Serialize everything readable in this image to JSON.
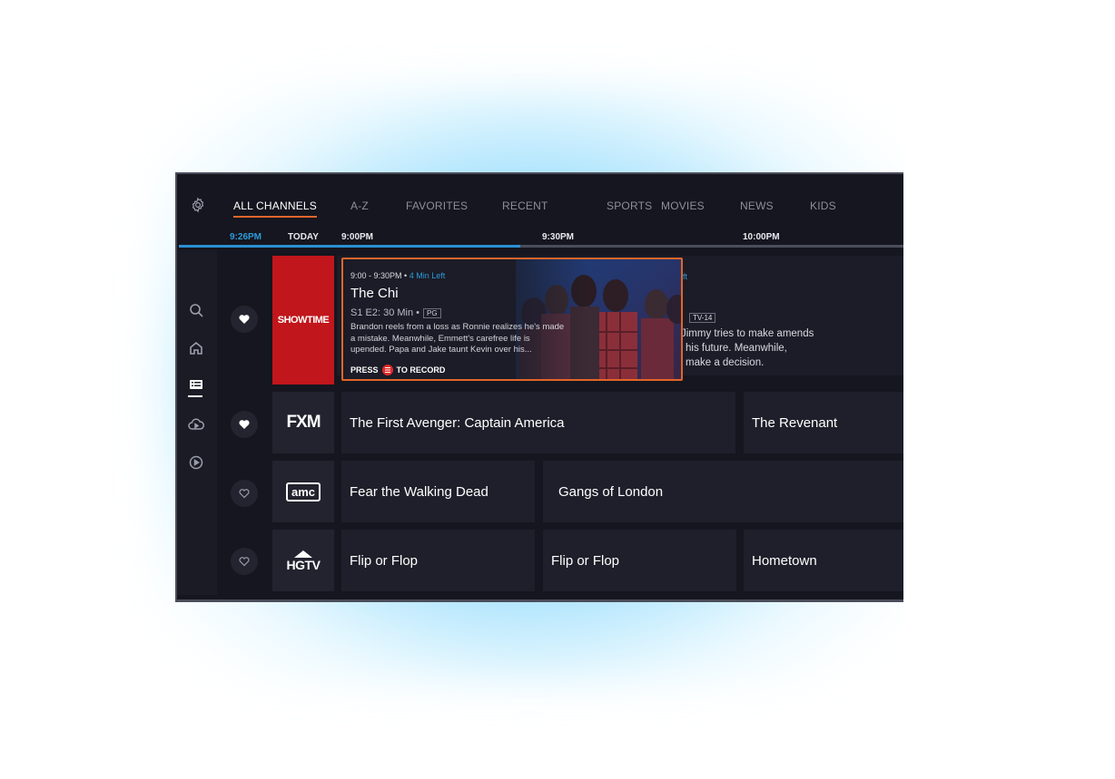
{
  "tabs": [
    "ALL CHANNELS",
    "A-Z",
    "FAVORITES",
    "RECENT",
    "SPORTS",
    "MOVIES",
    "NEWS",
    "KIDS"
  ],
  "timeline": {
    "now": "9:26PM",
    "day": "TODAY",
    "slots": [
      "9:00PM",
      "9:30PM",
      "10:00PM"
    ],
    "progress": 0.47
  },
  "sidenav": [
    "search-icon",
    "home-icon",
    "guide-icon",
    "cloud-dvr-icon",
    "play-icon"
  ],
  "focused": {
    "time": "9:00 - 9:30PM",
    "time_left": "4 Min Left",
    "title": "The Chi",
    "episode": "S1 E2: 30 Min",
    "rating": "PG",
    "description": "Brandon reels from a loss as Ronnie realizes he's made a mistake. Meanwhile, Emmett's carefree life is upended. Papa and Jake taunt Kevin over his...",
    "record_press": "PRESS",
    "record_label": "TO RECORD"
  },
  "behind": {
    "time_left_fragment": "ft",
    "rating": "TV-14",
    "desc1": "Jimmy tries to make amends",
    "desc2": "his future. Meanwhile,",
    "desc3": "make a decision."
  },
  "channels": [
    {
      "logo": "SHOWTIME",
      "favorite": true
    },
    {
      "logo": "FXM",
      "favorite": true,
      "programs": [
        "The First Avenger: Captain America",
        "The Revenant"
      ]
    },
    {
      "logo": "amc",
      "favorite": false,
      "programs": [
        "Fear the Walking Dead",
        "Gangs of London"
      ]
    },
    {
      "logo": "HGTV",
      "favorite": false,
      "programs": [
        "Flip or Flop",
        "Flip or Flop",
        "Hometown"
      ]
    }
  ],
  "colors": {
    "accent": "#e2652a",
    "progress": "#2c8fd1",
    "background": "#15161f"
  }
}
